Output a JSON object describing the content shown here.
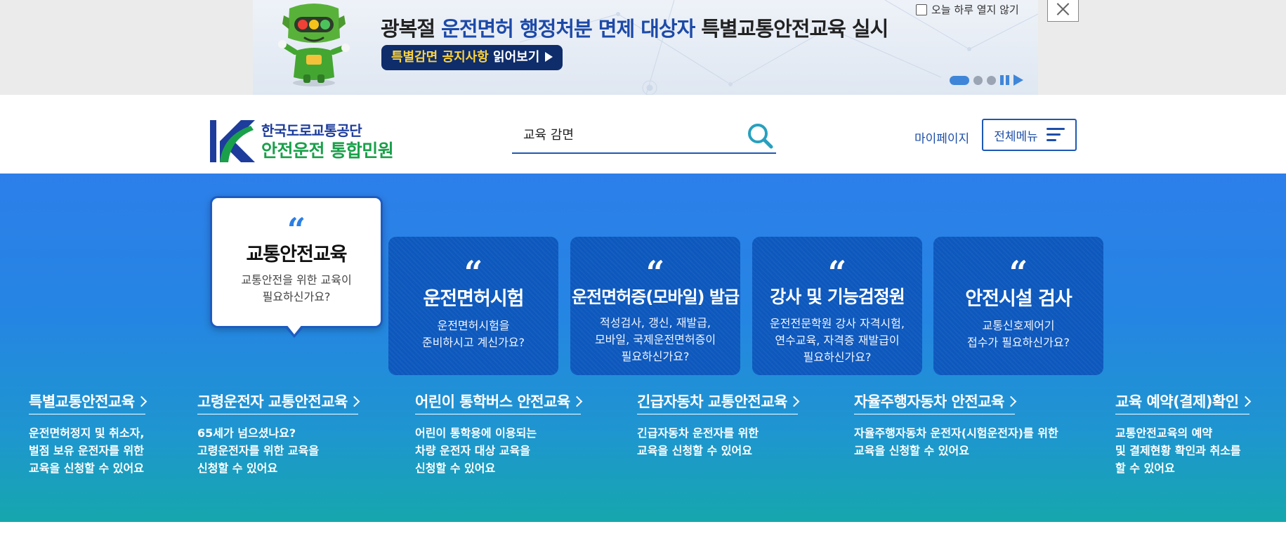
{
  "banner": {
    "title_part1": "광복절 ",
    "title_highlight": "운전면허 행정처분 면제 대상자",
    "title_part2": " 특별교통안전교육 실시",
    "link_highlight": "특별감면 공지사항",
    "link_rest": " 읽어보기",
    "no_today_label": "오늘 하루 열지 않기",
    "slide_count": 3,
    "active_slide": 1
  },
  "header": {
    "logo_line1": "한국도로교통공단",
    "logo_line2": "안전운전 통합민원",
    "search_value": "교육 감면",
    "mypage": "마이페이지",
    "all_menu": "전체메뉴"
  },
  "cards": [
    {
      "quote": "“",
      "title": "교통안전교육",
      "desc": "교통안전을 위한 교육이\n필요하신가요?"
    },
    {
      "quote": "“",
      "title": "운전면허시험",
      "desc": "운전면허시험을\n준비하시고 계신가요?"
    },
    {
      "quote": "“",
      "title": "운전면허증(모바일) 발급",
      "desc": "적성검사, 갱신, 재발급,\n모바일, 국제운전면허증이\n필요하신가요?"
    },
    {
      "quote": "“",
      "title": "강사 및 기능검정원",
      "desc": "운전전문학원 강사 자격시험,\n연수교육, 자격증 재발급이\n필요하신가요?"
    },
    {
      "quote": "“",
      "title": "안전시설 검사",
      "desc": "교통신호제어기\n접수가 필요하신가요?"
    }
  ],
  "sublinks": [
    {
      "title": "특별교통안전교육",
      "desc": "운전면허정지 및 취소자,\n벌점 보유 운전자를 위한\n교육을 신청할 수 있어요"
    },
    {
      "title": "고령운전자 교통안전교육",
      "desc": "65세가 넘으셨나요?\n고령운전자를 위한 교육을\n신청할 수 있어요"
    },
    {
      "title": "어린이 통학버스 안전교육",
      "desc": "어린이 통학용에 이용되는\n차량 운전자 대상 교육을\n신청할 수 있어요"
    },
    {
      "title": "긴급자동차 교통안전교육",
      "desc": "긴급자동차 운전자를 위한\n교육을 신청할 수 있어요"
    },
    {
      "title": "자율주행자동차 안전교육",
      "desc": "자율주행자동차 운전자(시험운전자)를 위한\n교육을 신청할 수 있어요"
    },
    {
      "title": "교육 예약(결제)확인",
      "desc": "교통안전교육의 예약\n및 결제현황 확인과 취소를\n할 수 있어요"
    }
  ],
  "colors": {
    "brand_blue": "#1d4ea8",
    "brand_green": "#1aa04a",
    "card_blue": "#0d58bd",
    "section_top": "#2d7fea",
    "section_bottom": "#16a7ad"
  }
}
